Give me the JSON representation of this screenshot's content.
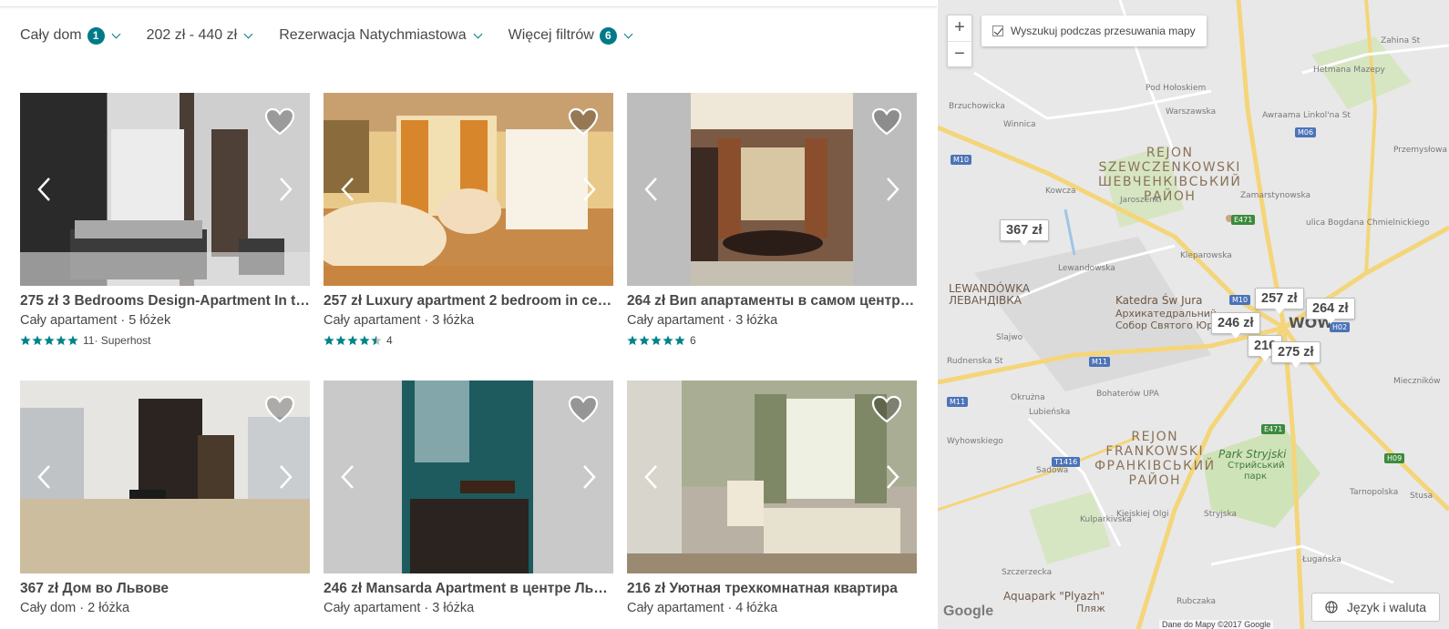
{
  "filters": [
    {
      "label": "Cały dom",
      "badge": "1"
    },
    {
      "label": "202 zł - 440 zł",
      "badge": null
    },
    {
      "label": "Rezerwacja Natychmiastowa",
      "badge": null
    },
    {
      "label": "Więcej filtrów",
      "badge": "6"
    }
  ],
  "listings": [
    {
      "title": "275 zł 3 Bedrooms Design-Apartment In th…",
      "subtitle": "Cały apartament · 5 łóżek",
      "rating_stars": 5,
      "reviews": "11",
      "extra": " · Superhost"
    },
    {
      "title": "257 zł Luxury apartment 2 bedroom in cen…",
      "subtitle": "Cały apartament · 3 łóżka",
      "rating_stars": 4.5,
      "reviews": "4",
      "extra": ""
    },
    {
      "title": "264 zł Вип апартаменты в самом центре …",
      "subtitle": "Cały apartament · 3 łóżka",
      "rating_stars": 5,
      "reviews": "6",
      "extra": ""
    },
    {
      "title": "367 zł Дом во Львове",
      "subtitle": "Cały dom · 2 łóżka"
    },
    {
      "title": "246 zł Mansarda Apartment в центре Льв…",
      "subtitle": "Cały apartament · 3 łóżka"
    },
    {
      "title": "216 zł Уютная трехкомнатная квартира",
      "subtitle": "Cały apartament · 4 łóżka"
    }
  ],
  "map": {
    "zoom_in": "+",
    "zoom_out": "−",
    "search_move_label": "Wyszukuj podczas przesuwania mapy",
    "search_move_checked": true,
    "price_pins": [
      "367 zł",
      "257 zł",
      "264 zł",
      "246 zł",
      "216",
      "275 zł"
    ],
    "districts": [
      {
        "line1": "REJON",
        "line2": "SZEWCZENKOWSKI",
        "line3": "ШЕВЧЕНКІВСЬКИЙ",
        "line4": "РАЙОН"
      },
      {
        "line1": "REJON",
        "line2": "FRANKOWSKI",
        "line3": "ФРАНКІВСЬКИЙ",
        "line4": "РАЙОН"
      }
    ],
    "labels": {
      "lewandowka": "LEWANDÓWKA",
      "lewandowka_uk": "ЛЕВАНДІВКА",
      "katedra": "Katedra Św Jura",
      "katedra_uk1": "Архикатедральний",
      "katedra_uk2": "Собор Святого Юра",
      "lwow": "WÓW",
      "park": "Park Stryjski",
      "park_uk1": "Стрийський",
      "park_uk2": "парк",
      "aquapark": "Aquapark \"Plyazh\"",
      "aquapark_uk": "Пляж"
    },
    "streets": [
      "Zahina St",
      "Hetmana Mazepy",
      "Pod Hołoskiem",
      "Warszawska",
      "Winnica",
      "Brzuchowicka",
      "Awraama Linkol'na St",
      "Przemysłowa",
      "ulica Bogdana Chmielnickiego",
      "Jaroszenki",
      "Kowcza",
      "Lewandowska",
      "Kleparowska",
      "Zamarstynowska",
      "Rudnenska St",
      "Slajwo",
      "Okrużna",
      "Lubieńska",
      "Bohaterów UPA",
      "Sadowa",
      "Wyhowskiego",
      "Kulparkivska",
      "Szczerzecka",
      "Rubczaka",
      "Ługańska",
      "Stusa",
      "Mieczników",
      "Tarnopolska",
      "Kiejskiej Olgi",
      "Stryjska"
    ],
    "shields": [
      "M10",
      "M06",
      "E471",
      "M10",
      "H02",
      "M11",
      "M11",
      "T1416",
      "E471",
      "H09"
    ],
    "google": "Google",
    "copyright": "Dane do Mapy ©2017 Google",
    "language_button": "Język i waluta"
  }
}
